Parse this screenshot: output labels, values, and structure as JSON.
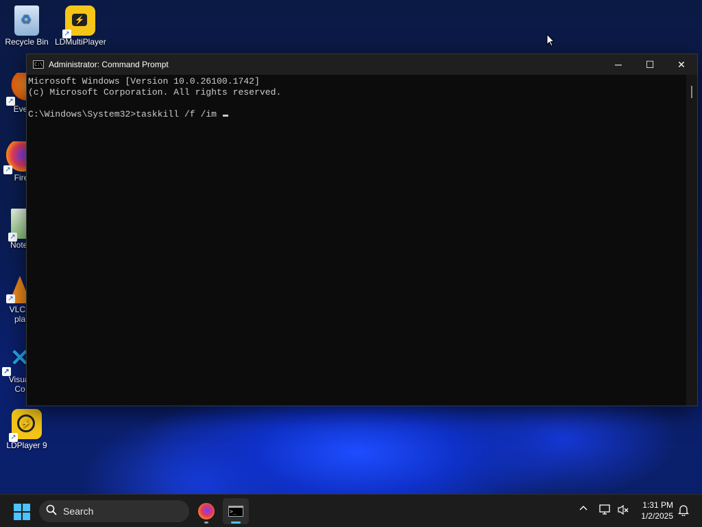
{
  "desktop": {
    "icons": [
      {
        "label": "Recycle Bin",
        "icon": "recycle-bin-icon"
      },
      {
        "label": "LDMultiPlayer",
        "icon": "ldmultiplayer-icon"
      },
      {
        "label": "Every",
        "icon": "everything-icon"
      },
      {
        "label": "Fire",
        "icon": "firefox-icon"
      },
      {
        "label": "Notep",
        "icon": "notepad-icon"
      },
      {
        "label": "VLC r",
        "label2": "pla",
        "icon": "vlc-icon"
      },
      {
        "label": "Visual",
        "label2": "Co",
        "icon": "vscode-icon"
      },
      {
        "label": "LDPlayer 9",
        "icon": "ldplayer-icon"
      }
    ]
  },
  "window": {
    "title": "Administrator: Command Prompt",
    "lines": [
      "Microsoft Windows [Version 10.0.26100.1742]",
      "(c) Microsoft Corporation. All rights reserved.",
      "",
      "C:\\Windows\\System32>taskkill /f /im "
    ],
    "controls": {
      "minimize": "─",
      "maximize": "☐",
      "close": "✕"
    }
  },
  "taskbar": {
    "search_placeholder": "Search",
    "pinned": [
      {
        "name": "firefox",
        "icon": "firefox-icon"
      },
      {
        "name": "command-prompt",
        "icon": "terminal-icon",
        "active": true
      }
    ],
    "tray": {
      "chevron": "^",
      "time": "1:31 PM",
      "date": "1/2/2025"
    }
  },
  "colors": {
    "accent": "#4cc2ff",
    "console_bg": "#0c0c0c",
    "console_text": "#cccccc",
    "titlebar": "#1f1f1f",
    "taskbar": "#1c1c1c"
  }
}
